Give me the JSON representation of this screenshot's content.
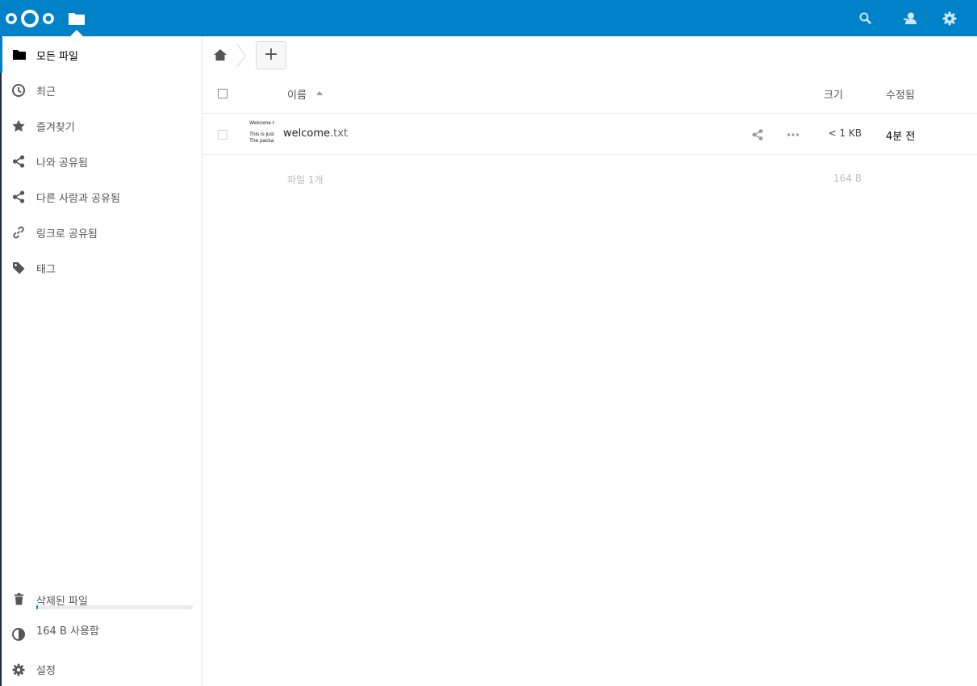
{
  "header": {
    "icons": [
      "nextcloud-logo",
      "files-app-icon",
      "search-icon",
      "contacts-icon",
      "settings-gear-icon"
    ],
    "color": "#0082c9"
  },
  "sidebar": {
    "items": [
      {
        "label": "모든 파일",
        "icon": "folder-icon",
        "active": true
      },
      {
        "label": "최근",
        "icon": "clock-icon"
      },
      {
        "label": "즐겨찾기",
        "icon": "star-icon"
      },
      {
        "label": "나와 공유됨",
        "icon": "share-icon"
      },
      {
        "label": "다른 사람과 공유됨",
        "icon": "share-icon"
      },
      {
        "label": "링크로 공유됨",
        "icon": "link-icon"
      },
      {
        "label": "태그",
        "icon": "tag-icon"
      }
    ],
    "trash_label": "삭제된 파일",
    "quota_label": "164 B 사용함",
    "quota_fraction": 0.01,
    "settings_label": "설정"
  },
  "table": {
    "col_name": "이름",
    "col_size": "크기",
    "col_modified": "수정됨",
    "files": [
      {
        "thumb_line1": "Welcome t",
        "thumb_line2": "This is just",
        "thumb_line3": "The packa",
        "name_base": "welcome",
        "name_ext": ".txt",
        "size": "< 1 KB",
        "modified": "4분 전"
      }
    ],
    "summary_count": "파일 1개",
    "summary_size": "164 B"
  }
}
